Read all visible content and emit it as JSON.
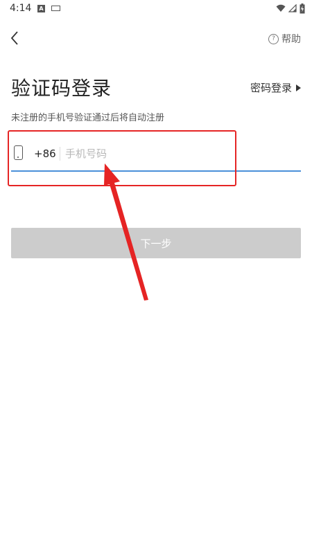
{
  "status_bar": {
    "time": "4:14",
    "notification_icons": [
      "app-a-icon",
      "keyboard-icon"
    ],
    "system_icons": [
      "wifi-icon",
      "signal-icon",
      "battery-charging-icon"
    ]
  },
  "header": {
    "back_icon": "back-chevron-icon",
    "help_label": "帮助",
    "help_icon": "question-circle-icon"
  },
  "main": {
    "title": "验证码登录",
    "password_login_label": "密码登录",
    "subtitle": "未注册的手机号验证通过后将自动注册",
    "phone": {
      "country_code": "+86",
      "placeholder": "手机号码",
      "value": ""
    },
    "next_button_label": "下一步"
  },
  "annotation": {
    "box_color": "#e52424",
    "arrow_color": "#e52424"
  },
  "colors": {
    "input_underline": "#4a90d9",
    "button_disabled_bg": "#cccccc"
  }
}
